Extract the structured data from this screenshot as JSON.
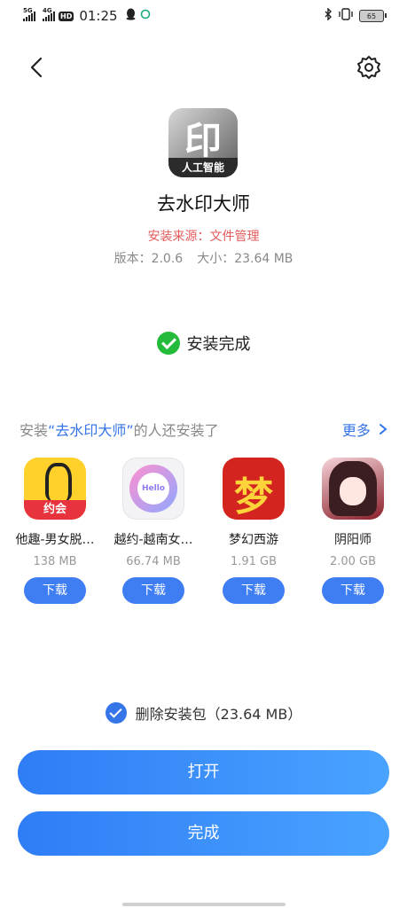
{
  "status_bar": {
    "sim1": "5G",
    "sim2": "4G",
    "hd": "HD",
    "time": "01:25",
    "battery": "65"
  },
  "app": {
    "icon_glyph": "印",
    "icon_label": "人工智能",
    "name": "去水印大师",
    "source": "安装来源：文件管理",
    "version": "版本：2.0.6",
    "size": "大小：23.64 MB"
  },
  "install": {
    "status": "安装完成"
  },
  "recommend": {
    "prefix": "安装",
    "quote_open": "“",
    "app": "去水印大师",
    "quote_close": "”",
    "suffix": "的人还安装了",
    "more": "更多",
    "icon_yellow_badge": "约会",
    "icon_hello_text": "Hello",
    "icon_dream_glyph": "梦",
    "items": [
      {
        "name": "他趣-男女脱…",
        "size": "138 MB",
        "button": "下载"
      },
      {
        "name": "越约-越南女…",
        "size": "66.74 MB",
        "button": "下载"
      },
      {
        "name": "梦幻西游",
        "size": "1.91 GB",
        "button": "下载"
      },
      {
        "name": "阴阳师",
        "size": "2.00 GB",
        "button": "下载"
      }
    ]
  },
  "delete_package": {
    "label": "删除安装包（23.64 MB）",
    "checked": true
  },
  "buttons": {
    "open": "打开",
    "done": "完成"
  },
  "colors": {
    "accent": "#3675e8",
    "success": "#24bb3a",
    "source_text": "#e35b5b"
  }
}
